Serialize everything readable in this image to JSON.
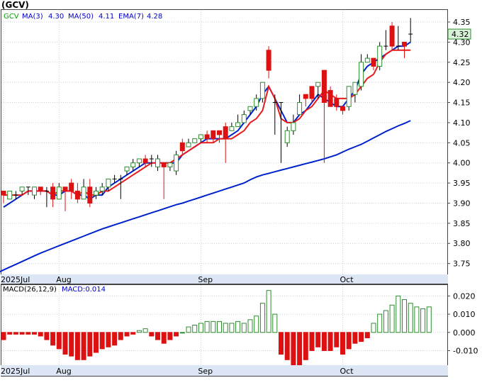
{
  "chart_data": [
    {
      "type": "candlestick",
      "title": "(GCV)",
      "legend": {
        "symbol": {
          "label": "GCV",
          "color": "#00a000"
        },
        "items": [
          {
            "label": "MA(3)",
            "value": "4.30",
            "color": "#0000cc"
          },
          {
            "label": "MA(50)",
            "value": "4.11",
            "color": "#0000cc"
          },
          {
            "label": "EMA(7)",
            "value": "4.28",
            "color": "#0000cc"
          }
        ]
      },
      "ylim": [
        3.7,
        4.38
      ],
      "yticks": [
        "4.35",
        "4.30",
        "4.25",
        "4.20",
        "4.15",
        "4.10",
        "4.05",
        "4.00",
        "3.95",
        "3.90",
        "3.85",
        "3.80",
        "3.75"
      ],
      "last_price": "4.32",
      "xticks": [
        {
          "label": "2025Jul",
          "bar": 0
        },
        {
          "label": "Aug",
          "bar": 9
        },
        {
          "label": "Sep",
          "bar": 32
        },
        {
          "label": "Oct",
          "bar": 55
        }
      ],
      "up_color": "#2e8b2e",
      "down_color": "#dd1111",
      "ma_color": "#0022cc",
      "ema_color": "#e81c1c",
      "candles": [
        [
          3.93,
          3.92,
          3.93,
          3.9
        ],
        [
          3.91,
          3.93,
          3.93,
          3.91
        ],
        [
          3.92,
          3.92,
          3.93,
          3.91
        ],
        [
          3.93,
          3.94,
          3.94,
          3.92
        ],
        [
          3.94,
          3.94,
          3.94,
          3.92
        ],
        [
          3.92,
          3.94,
          3.94,
          3.91
        ],
        [
          3.94,
          3.93,
          3.94,
          3.92
        ],
        [
          3.93,
          3.93,
          3.94,
          3.89
        ],
        [
          3.94,
          3.91,
          3.95,
          3.89
        ],
        [
          3.91,
          3.94,
          3.95,
          3.91
        ],
        [
          3.94,
          3.93,
          3.94,
          3.88
        ],
        [
          3.95,
          3.93,
          3.96,
          3.91
        ],
        [
          3.93,
          3.91,
          3.95,
          3.9
        ],
        [
          3.91,
          3.94,
          3.96,
          3.91
        ],
        [
          3.94,
          3.9,
          3.96,
          3.89
        ],
        [
          3.92,
          3.93,
          3.94,
          3.91
        ],
        [
          3.93,
          3.94,
          3.95,
          3.92
        ],
        [
          3.94,
          3.96,
          3.96,
          3.93
        ],
        [
          3.96,
          3.96,
          3.97,
          3.95
        ],
        [
          3.96,
          3.96,
          3.97,
          3.91
        ],
        [
          3.98,
          3.99,
          3.99,
          3.97
        ],
        [
          3.99,
          4.0,
          4.01,
          3.98
        ],
        [
          4.0,
          4.01,
          4.01,
          3.99
        ],
        [
          4.01,
          4.0,
          4.02,
          3.99
        ],
        [
          4.01,
          4.01,
          4.02,
          3.99
        ],
        [
          3.99,
          4.01,
          4.02,
          3.98
        ],
        [
          4.0,
          3.99,
          4.0,
          3.91
        ],
        [
          3.99,
          4.0,
          4.0,
          3.98
        ],
        [
          3.98,
          4.02,
          4.03,
          3.97
        ],
        [
          4.05,
          4.03,
          4.06,
          4.02
        ],
        [
          4.04,
          4.05,
          4.06,
          4.04
        ],
        [
          4.05,
          4.06,
          4.06,
          4.05
        ],
        [
          4.06,
          4.07,
          4.07,
          4.05
        ],
        [
          4.07,
          4.06,
          4.08,
          4.05
        ],
        [
          4.08,
          4.06,
          4.08,
          4.05
        ],
        [
          4.08,
          4.07,
          4.08,
          4.05
        ],
        [
          4.09,
          4.06,
          4.1,
          4.0
        ],
        [
          4.08,
          4.09,
          4.1,
          4.08
        ],
        [
          4.09,
          4.1,
          4.12,
          4.09
        ],
        [
          4.1,
          4.12,
          4.13,
          4.11
        ],
        [
          4.13,
          4.14,
          4.14,
          4.12
        ],
        [
          4.14,
          4.16,
          4.17,
          4.13
        ],
        [
          4.16,
          4.2,
          4.2,
          4.15
        ],
        [
          4.28,
          4.23,
          4.29,
          4.21
        ],
        [
          4.15,
          4.15,
          4.17,
          4.07
        ],
        [
          4.15,
          4.15,
          4.15,
          4.0
        ],
        [
          4.05,
          4.08,
          4.09,
          4.04
        ],
        [
          4.08,
          4.1,
          4.12,
          4.07
        ],
        [
          4.12,
          4.15,
          4.17,
          4.12
        ],
        [
          4.17,
          4.16,
          4.17,
          4.14
        ],
        [
          4.19,
          4.16,
          4.19,
          4.15
        ],
        [
          4.19,
          4.2,
          4.2,
          4.16
        ],
        [
          4.23,
          4.15,
          4.23,
          4.0
        ],
        [
          4.18,
          4.14,
          4.19,
          4.14
        ],
        [
          4.16,
          4.14,
          4.17,
          4.13
        ],
        [
          4.14,
          4.13,
          4.14,
          4.12
        ],
        [
          4.14,
          4.19,
          4.19,
          4.13
        ],
        [
          4.17,
          4.2,
          4.2,
          4.15
        ],
        [
          4.19,
          4.25,
          4.27,
          4.18
        ],
        [
          4.25,
          4.26,
          4.27,
          4.25
        ],
        [
          4.26,
          4.24,
          4.26,
          4.23
        ],
        [
          4.24,
          4.29,
          4.3,
          4.23
        ],
        [
          4.29,
          4.29,
          4.33,
          4.28
        ],
        [
          4.34,
          4.29,
          4.35,
          4.28
        ],
        [
          4.29,
          4.29,
          4.34,
          4.28
        ],
        [
          4.3,
          4.29,
          4.3,
          4.26
        ],
        [
          4.32,
          4.32,
          4.36,
          4.3
        ]
      ],
      "ema7": [
        3.92,
        3.92,
        3.92,
        3.92,
        3.93,
        3.93,
        3.93,
        3.93,
        3.92,
        3.93,
        3.93,
        3.93,
        3.92,
        3.93,
        3.92,
        3.92,
        3.93,
        3.93,
        3.94,
        3.95,
        3.96,
        3.97,
        3.98,
        3.99,
        4.0,
        4.0,
        4.0,
        4.0,
        4.01,
        4.02,
        4.03,
        4.04,
        4.05,
        4.05,
        4.05,
        4.06,
        4.06,
        4.06,
        4.07,
        4.08,
        4.1,
        4.11,
        4.13,
        4.19,
        4.16,
        4.11,
        4.1,
        4.1,
        4.11,
        4.13,
        4.14,
        4.16,
        4.18,
        4.17,
        4.16,
        4.16,
        4.16,
        4.17,
        4.19,
        4.21,
        4.22,
        4.25,
        4.27,
        4.28,
        4.28,
        4.28,
        4.28
      ],
      "ma3": [
        3.89,
        3.9,
        3.91,
        3.92,
        3.93,
        3.93,
        3.93,
        3.93,
        3.92,
        3.92,
        3.93,
        3.93,
        3.92,
        3.92,
        3.91,
        3.92,
        3.92,
        3.94,
        3.95,
        3.96,
        3.97,
        3.98,
        3.99,
        4.0,
        4.0,
        4.0,
        4.0,
        4.0,
        4.0,
        4.02,
        4.03,
        4.04,
        4.05,
        4.06,
        4.06,
        4.06,
        4.06,
        4.07,
        4.08,
        4.1,
        4.12,
        4.14,
        4.17,
        4.19,
        4.16,
        4.13,
        4.1,
        4.1,
        4.12,
        4.13,
        4.15,
        4.17,
        4.16,
        4.15,
        4.14,
        4.14,
        4.16,
        4.18,
        4.22,
        4.24,
        4.25,
        4.26,
        4.27,
        4.28,
        4.29,
        4.29,
        4.3
      ],
      "ma50": [
        3.71,
        3.715,
        3.72,
        3.727,
        3.734,
        3.741,
        3.748,
        3.755,
        3.762,
        3.769,
        3.776,
        3.782,
        3.788,
        3.794,
        3.8,
        3.806,
        3.812,
        3.818,
        3.824,
        3.83,
        3.836,
        3.841,
        3.846,
        3.851,
        3.856,
        3.861,
        3.866,
        3.871,
        3.876,
        3.881,
        3.886,
        3.891,
        3.896,
        3.9,
        3.905,
        3.91,
        3.915,
        3.92,
        3.925,
        3.93,
        3.935,
        3.94,
        3.945,
        3.95,
        3.958,
        3.965,
        3.97,
        3.974,
        3.978,
        3.982,
        3.986,
        3.99,
        3.994,
        3.998,
        4.002,
        4.006,
        4.01,
        4.015,
        4.02,
        4.027,
        4.034,
        4.04,
        4.046,
        4.054,
        4.062,
        4.07,
        4.078,
        4.085,
        4.092,
        4.098,
        4.105
      ]
    },
    {
      "type": "bar",
      "title": "",
      "legend": {
        "symbol": {
          "label": "MACD(26,12,9)",
          "color": "#000000"
        },
        "items": [
          {
            "label": "MACD",
            "value": "0.014",
            "color": "#0000cc"
          }
        ]
      },
      "ylim": [
        -0.018,
        0.026
      ],
      "yticks": [
        "0.020",
        "0.010",
        "0.000",
        "-0.010"
      ],
      "xticks": [
        {
          "label": "2025Jul",
          "bar": 0
        },
        {
          "label": "Aug",
          "bar": 9
        },
        {
          "label": "Sep",
          "bar": 32
        },
        {
          "label": "Oct",
          "bar": 55
        }
      ],
      "values": [
        -0.004,
        -0.001,
        -0.001,
        -0.001,
        -0.001,
        -0.001,
        -0.002,
        -0.004,
        -0.007,
        -0.009,
        -0.012,
        -0.013,
        -0.015,
        -0.015,
        -0.013,
        -0.011,
        -0.009,
        -0.008,
        -0.007,
        -0.004,
        -0.002,
        -0.001,
        0.001,
        0.002,
        -0.002,
        -0.004,
        -0.006,
        -0.004,
        -0.002,
        0.0,
        0.003,
        0.004,
        0.005,
        0.006,
        0.006,
        0.006,
        0.005,
        0.005,
        0.006,
        0.005,
        0.007,
        0.009,
        0.016,
        0.023,
        0.01,
        -0.012,
        -0.015,
        -0.02,
        -0.02,
        -0.015,
        -0.01,
        -0.008,
        -0.01,
        -0.01,
        -0.008,
        -0.012,
        -0.009,
        -0.006,
        -0.005,
        -0.003,
        0.005,
        0.01,
        0.012,
        0.015,
        0.02,
        0.018,
        0.016,
        0.014,
        0.013,
        0.014
      ]
    }
  ]
}
